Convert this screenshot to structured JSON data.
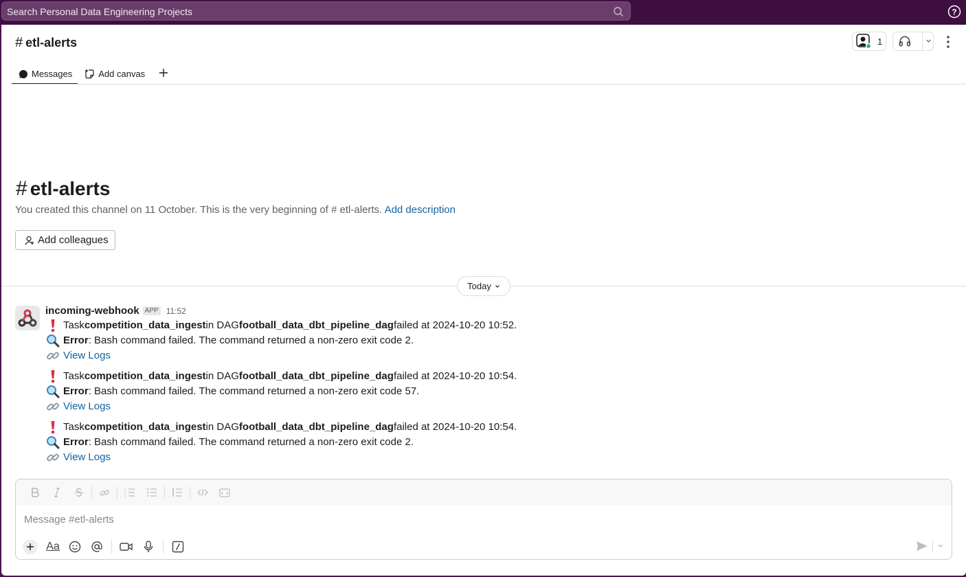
{
  "search": {
    "placeholder": "Search Personal Data Engineering Projects"
  },
  "header": {
    "channel_hash": "#",
    "channel_name": "etl-alerts",
    "member_count": "1"
  },
  "tabs": [
    {
      "label": "Messages",
      "icon": "chat-bubble-icon"
    },
    {
      "label": "Add canvas",
      "icon": "canvas-icon"
    }
  ],
  "intro": {
    "hash": "#",
    "title": "etl-alerts",
    "desc_prefix": "You created this channel on 11 October. This is the very beginning of",
    "desc_hash": "#",
    "desc_channel": " etl-alerts.",
    "desc_link": "Add description",
    "add_colleagues": "Add colleagues"
  },
  "divider": {
    "label": "Today"
  },
  "message": {
    "sender": "incoming-webhook",
    "badge": "APP",
    "time": "11:52",
    "alerts": [
      {
        "l1_a": "Task ",
        "task": "competition_data_ingest",
        "l1_b": " in DAG ",
        "dag": "football_data_dbt_pipeline_dag",
        "l1_c": " failed at 2024-10-20 10:52.",
        "err_label": "Error",
        "err_text": ": Bash command failed. The command returned a non-zero exit code 2.",
        "link": "View Logs"
      },
      {
        "l1_a": "Task ",
        "task": "competition_data_ingest",
        "l1_b": " in DAG ",
        "dag": "football_data_dbt_pipeline_dag",
        "l1_c": " failed at 2024-10-20 10:54.",
        "err_label": "Error",
        "err_text": ": Bash command failed. The command returned a non-zero exit code 57.",
        "link": "View Logs"
      },
      {
        "l1_a": "Task ",
        "task": "competition_data_ingest",
        "l1_b": " in DAG ",
        "dag": "football_data_dbt_pipeline_dag",
        "l1_c": " failed at 2024-10-20 10:54.",
        "err_label": "Error",
        "err_text": ": Bash command failed. The command returned a non-zero exit code 2.",
        "link": "View Logs"
      }
    ]
  },
  "composer": {
    "placeholder": "Message #etl-alerts",
    "format_label": "Aa"
  },
  "colors": {
    "workspace": "#3f0e40",
    "link": "#1264a3",
    "alert_red": "#dd2e44"
  }
}
